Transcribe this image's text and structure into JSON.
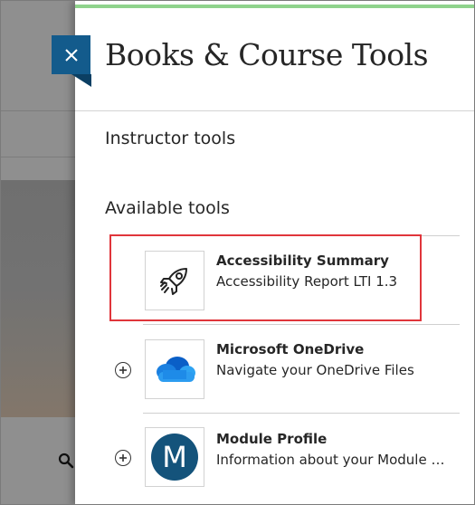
{
  "panel": {
    "title": "Books & Course Tools",
    "close_label": "×"
  },
  "sections": {
    "instructor": "Instructor tools",
    "available": "Available tools"
  },
  "tools": [
    {
      "name": "Accessibility Summary",
      "description": "Accessibility Report LTI 1.3",
      "icon": "rocket-icon",
      "highlighted": true
    },
    {
      "name": "Microsoft OneDrive",
      "description": "Navigate your OneDrive Files",
      "icon": "onedrive-cloud-icon"
    },
    {
      "name": "Module Profile",
      "description": "Information about your Module with Module Profile details",
      "icon": "module-profile-avatar",
      "avatar_letter": "M"
    }
  ],
  "colors": {
    "close_tab": "#135b8c",
    "accent_strip": "#8fd38c",
    "highlight_box": "#e0353b",
    "module_avatar": "#14537b"
  }
}
